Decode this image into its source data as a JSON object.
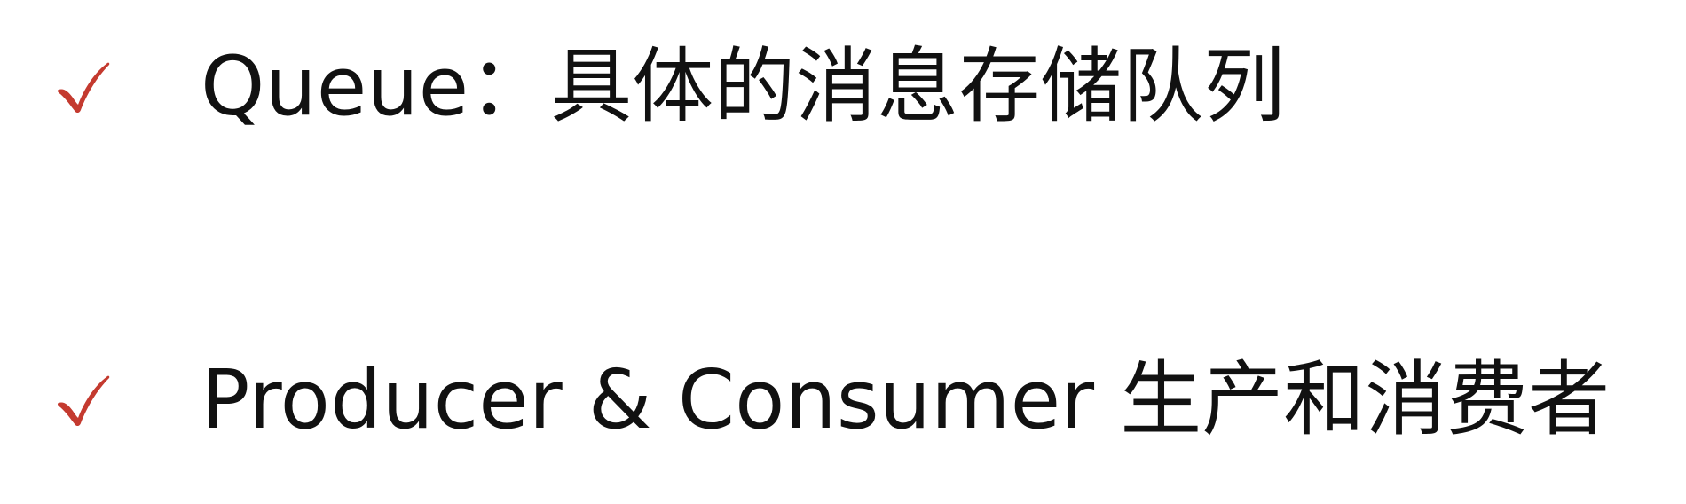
{
  "slide": {
    "bullets": [
      {
        "text": "Queue：具体的消息存储队列",
        "icon": "checkmark-icon",
        "icon_color": "#c43a2f"
      },
      {
        "text": "Producer & Consumer 生产和消费者",
        "icon": "checkmark-icon",
        "icon_color": "#c43a2f"
      }
    ]
  }
}
